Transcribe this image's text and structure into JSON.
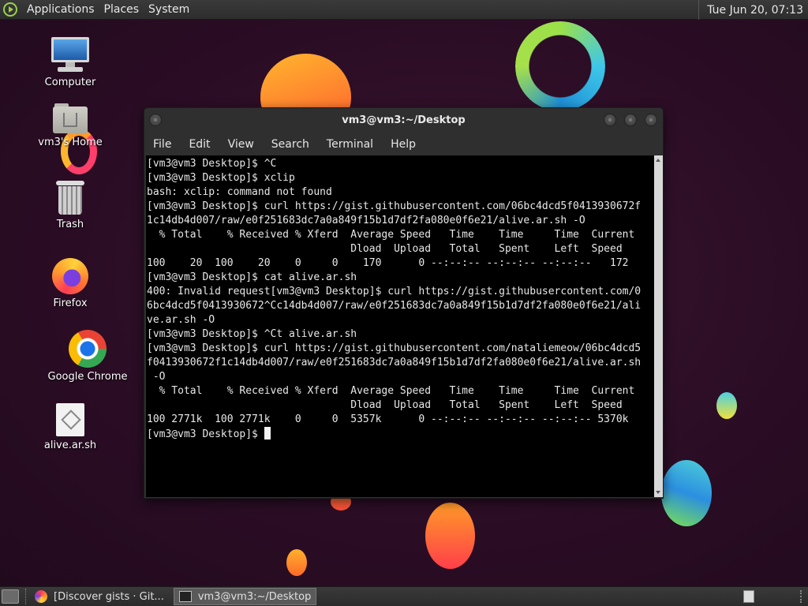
{
  "top_panel": {
    "menus": [
      "Applications",
      "Places",
      "System"
    ],
    "clock": "Tue Jun 20, 07:13",
    "app_icon": "distro-logo-icon"
  },
  "desktop_icons": [
    {
      "label": "Computer",
      "icon": "computer-icon"
    },
    {
      "label": "vm3's Home",
      "icon": "home-folder-icon"
    },
    {
      "label": "Trash",
      "icon": "trash-icon"
    },
    {
      "label": "Firefox",
      "icon": "firefox-icon"
    },
    {
      "label": "Google Chrome",
      "icon": "chrome-icon"
    },
    {
      "label": "alive.ar.sh",
      "icon": "script-file-icon"
    }
  ],
  "terminal": {
    "title": "vm3@vm3:~/Desktop",
    "menu": [
      "File",
      "Edit",
      "View",
      "Search",
      "Terminal",
      "Help"
    ],
    "lines": [
      "[vm3@vm3 Desktop]$ ^C",
      "[vm3@vm3 Desktop]$ xclip",
      "bash: xclip: command not found",
      "[vm3@vm3 Desktop]$ curl https://gist.githubusercontent.com/06bc4dcd5f0413930672f",
      "1c14db4d007/raw/e0f251683dc7a0a849f15b1d7df2fa080e0f6e21/alive.ar.sh -O",
      "  % Total    % Received % Xferd  Average Speed   Time    Time     Time  Current",
      "                                 Dload  Upload   Total   Spent    Left  Speed",
      "100    20  100    20    0     0    170      0 --:--:-- --:--:-- --:--:--   172",
      "[vm3@vm3 Desktop]$ cat alive.ar.sh",
      "400: Invalid request[vm3@vm3 Desktop]$ curl https://gist.githubusercontent.com/0",
      "6bc4dcd5f0413930672^Cc14db4d007/raw/e0f251683dc7a0a849f15b1d7df2fa080e0f6e21/ali",
      "ve.ar.sh -O",
      "[vm3@vm3 Desktop]$ ^Ct alive.ar.sh",
      "[vm3@vm3 Desktop]$ curl https://gist.githubusercontent.com/nataliemeow/06bc4dcd5",
      "f0413930672f1c14db4d007/raw/e0f251683dc7a0a849f15b1d7df2fa080e0f6e21/alive.ar.sh",
      " -O",
      "  % Total    % Received % Xferd  Average Speed   Time    Time     Time  Current",
      "                                 Dload  Upload   Total   Spent    Left  Speed",
      "100 2771k  100 2771k    0     0  5357k      0 --:--:-- --:--:-- --:--:-- 5370k"
    ],
    "prompt": "[vm3@vm3 Desktop]$ "
  },
  "taskbar": {
    "tasks": [
      {
        "label": "[Discover gists · Git...",
        "icon": "firefox-icon",
        "active": false
      },
      {
        "label": "vm3@vm3:~/Desktop",
        "icon": "terminal-icon",
        "active": true
      }
    ]
  }
}
